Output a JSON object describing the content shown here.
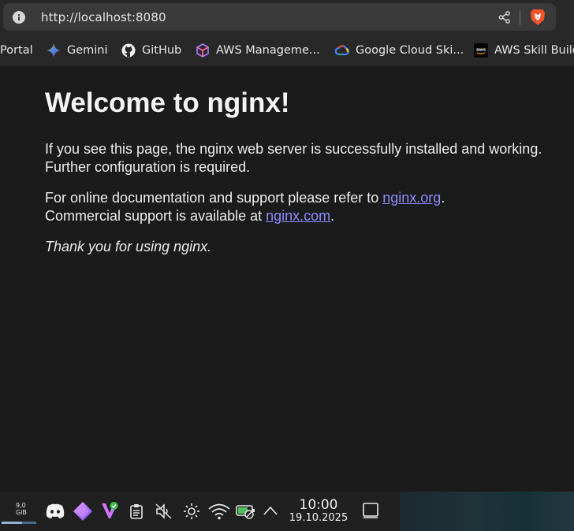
{
  "browser": {
    "url": "http://localhost:8080",
    "icons": {
      "info": "info-icon",
      "share": "share-icon",
      "brave": "brave-lion-icon"
    }
  },
  "bookmarks": [
    {
      "label": "Portal",
      "icon": ""
    },
    {
      "label": "Gemini",
      "icon": "gemini-star-icon"
    },
    {
      "label": "GitHub",
      "icon": "github-icon"
    },
    {
      "label": "AWS Manageme...",
      "icon": "aws-cube-icon"
    },
    {
      "label": "Google Cloud Ski...",
      "icon": "google-cloud-icon"
    },
    {
      "label": "AWS Skill Build",
      "icon": "aws-logo-icon"
    }
  ],
  "page": {
    "title": "Welcome to nginx!",
    "p1_line1": "If you see this page, the nginx web server is successfully installed and working.",
    "p1_line2": "Further configuration is required.",
    "p2_prefix": "For online documentation and support please refer to ",
    "p2_link": "nginx.org",
    "p2_suffix": ".",
    "p3_prefix": "Commercial support is available at ",
    "p3_link": "nginx.com",
    "p3_suffix": ".",
    "thanks": "Thank you for using nginx.",
    "link_color": "#8d8bff"
  },
  "taskbar": {
    "memory": {
      "label": "9,0 GiB",
      "usage_fraction": 0.6
    },
    "tray_icons": [
      "discord-icon",
      "gem-app-icon",
      "vpn-shield-icon",
      "clipboard-icon",
      "speaker-muted-icon",
      "brightness-icon",
      "wifi-icon",
      "battery-charging-icon",
      "chevron-up-icon"
    ],
    "clock": {
      "time": "10:00",
      "date": "19.10.2025"
    },
    "show_desktop_icon": "show-desktop-icon"
  }
}
